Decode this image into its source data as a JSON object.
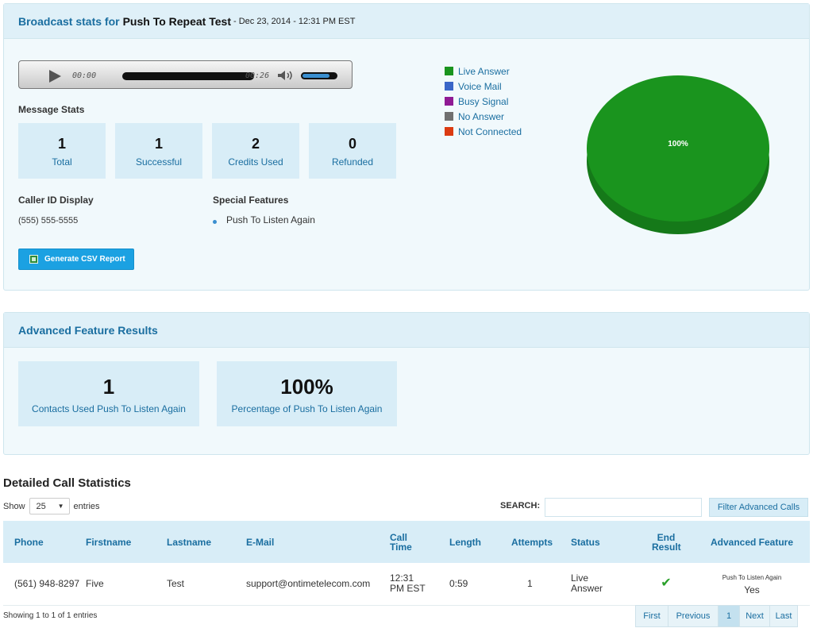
{
  "broadcast": {
    "title_prefix": "Broadcast stats for",
    "title_name": "Push To Repeat Test",
    "title_date": "- Dec 23, 2014 - 12:31 PM EST"
  },
  "player": {
    "current_time": "00:00",
    "duration": "00:26",
    "volume_level": 0.8
  },
  "message_stats": {
    "heading": "Message Stats",
    "boxes": [
      {
        "value": "1",
        "label": "Total"
      },
      {
        "value": "1",
        "label": "Successful"
      },
      {
        "value": "2",
        "label": "Credits Used"
      },
      {
        "value": "0",
        "label": "Refunded"
      }
    ]
  },
  "caller_id": {
    "heading": "Caller ID Display",
    "value": "(555) 555-5555"
  },
  "special_features": {
    "heading": "Special Features",
    "items": [
      "Push To Listen Again"
    ]
  },
  "csv_button": {
    "label": "Generate CSV Report"
  },
  "legend": [
    {
      "label": "Live Answer",
      "color": "#1a941e"
    },
    {
      "label": "Voice Mail",
      "color": "#3a66c8"
    },
    {
      "label": "Busy Signal",
      "color": "#8f1a94"
    },
    {
      "label": "No Answer",
      "color": "#707070"
    },
    {
      "label": "Not Connected",
      "color": "#db3b12"
    }
  ],
  "chart_data": {
    "type": "pie",
    "categories": [
      "Live Answer",
      "Voice Mail",
      "Busy Signal",
      "No Answer",
      "Not Connected"
    ],
    "values": [
      100,
      0,
      0,
      0,
      0
    ],
    "slice_labels": [
      "100%"
    ]
  },
  "advanced": {
    "heading": "Advanced Feature Results",
    "boxes": [
      {
        "value": "1",
        "label": "Contacts Used Push To Listen Again"
      },
      {
        "value": "100%",
        "label": "Percentage of Push To Listen Again"
      }
    ]
  },
  "calls": {
    "heading": "Detailed Call Statistics",
    "show_label": "Show",
    "entries_value": "25",
    "entries_label": "entries",
    "search_label": "SEARCH:",
    "filter_button": "Filter Advanced Calls",
    "columns": [
      "Phone",
      "Firstname",
      "Lastname",
      "E-Mail",
      "Call Time",
      "Length",
      "Attempts",
      "Status",
      "End Result",
      "Advanced Feature"
    ],
    "rows": [
      {
        "phone": "(561) 948-8297",
        "firstname": "Five",
        "lastname": "Test",
        "email": "support@ontimetelecom.com",
        "call_time_1": "12:31",
        "call_time_2": "PM EST",
        "length": "0:59",
        "attempts": "1",
        "status_1": "Live",
        "status_2": "Answer",
        "end_result_icon": "check-icon",
        "advanced_feature_name": "Push To Listen Again",
        "advanced_feature_value": "Yes"
      }
    ],
    "info": "Showing 1 to 1 of 1 entries",
    "pager": [
      "First",
      "Previous",
      "1",
      "Next",
      "Last"
    ],
    "current_page": "1"
  }
}
